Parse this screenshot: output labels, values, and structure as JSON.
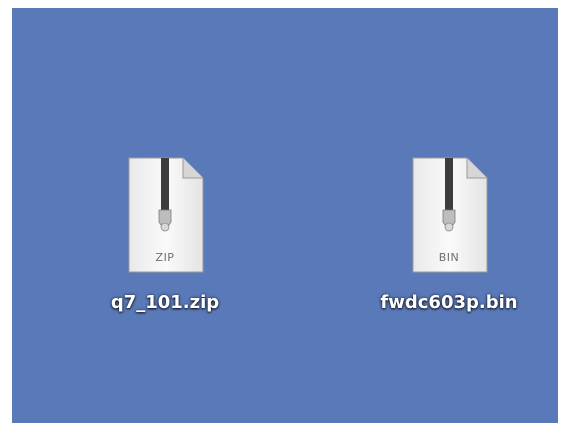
{
  "desktop": {
    "background_color": "#5a79b9",
    "files": [
      {
        "name": "q7_101.zip",
        "type_badge": "ZIP",
        "icon": "zip-archive-icon"
      },
      {
        "name": "fwdc603p.bin",
        "type_badge": "BIN",
        "icon": "bin-archive-icon"
      }
    ]
  }
}
